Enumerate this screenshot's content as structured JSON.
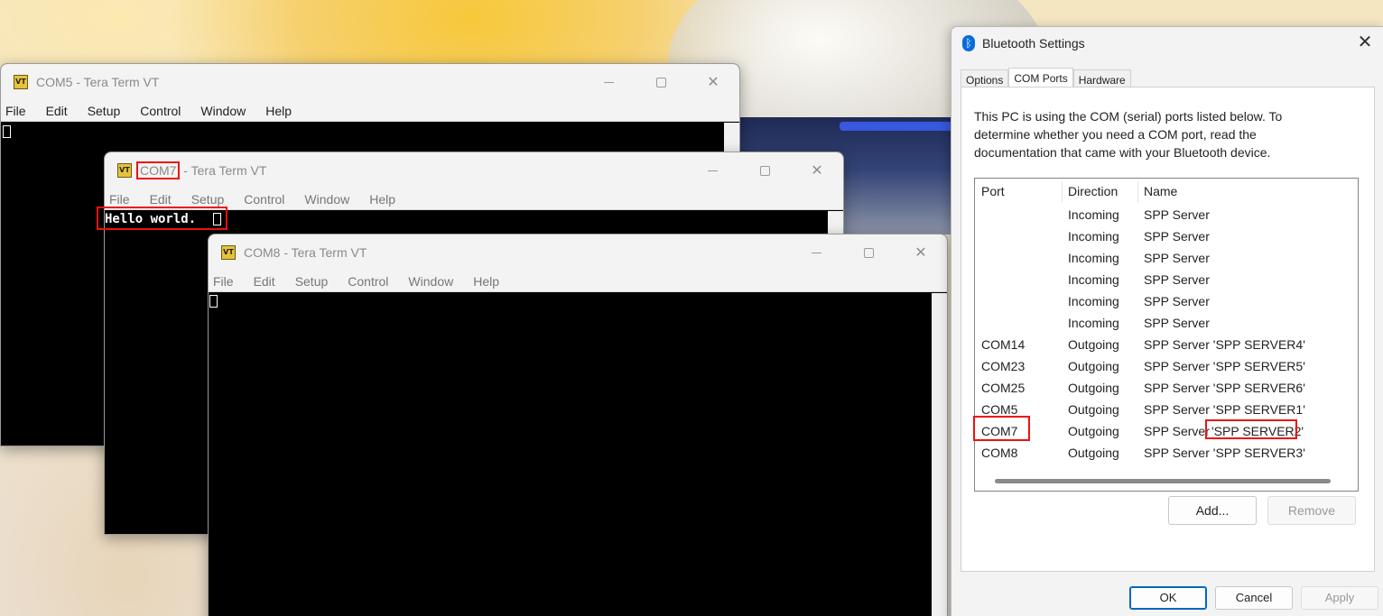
{
  "windows": {
    "com5": {
      "title": "COM5 - Tera Term VT",
      "menu": [
        "File",
        "Edit",
        "Setup",
        "Control",
        "Window",
        "Help"
      ]
    },
    "com7": {
      "title_port": "COM7",
      "title_rest": " - Tera Term VT",
      "menu": [
        "File",
        "Edit",
        "Setup",
        "Control",
        "Window",
        "Help"
      ],
      "terminal_text": "Hello world."
    },
    "com8": {
      "title": "COM8 - Tera Term VT",
      "menu": [
        "File",
        "Edit",
        "Setup",
        "Control",
        "Window",
        "Help"
      ]
    }
  },
  "icons": {
    "tera_term_icon": "VT",
    "bluetooth_icon": "ᛒ",
    "close_icon": "✕"
  },
  "bluetooth": {
    "title": "Bluetooth Settings",
    "tabs": [
      "Options",
      "COM Ports",
      "Hardware"
    ],
    "active_tab": "COM Ports",
    "description": "This PC is using the COM (serial) ports listed below. To determine whether you need a COM port, read the documentation that came with your Bluetooth device.",
    "columns": [
      "Port",
      "Direction",
      "Name"
    ],
    "rows": [
      {
        "port": "",
        "direction": "Incoming",
        "name": "SPP Server"
      },
      {
        "port": "",
        "direction": "Incoming",
        "name": "SPP Server"
      },
      {
        "port": "",
        "direction": "Incoming",
        "name": "SPP Server"
      },
      {
        "port": "",
        "direction": "Incoming",
        "name": "SPP Server"
      },
      {
        "port": "",
        "direction": "Incoming",
        "name": "SPP Server"
      },
      {
        "port": "",
        "direction": "Incoming",
        "name": "SPP Server"
      },
      {
        "port": "COM14",
        "direction": "Outgoing",
        "name": "SPP Server 'SPP SERVER4'"
      },
      {
        "port": "COM23",
        "direction": "Outgoing",
        "name": "SPP Server 'SPP SERVER5'"
      },
      {
        "port": "COM25",
        "direction": "Outgoing",
        "name": "SPP Server 'SPP SERVER6'"
      },
      {
        "port": "COM5",
        "direction": "Outgoing",
        "name": "SPP Server 'SPP SERVER1'"
      },
      {
        "port": "COM7",
        "direction": "Outgoing",
        "name_prefix": "SPP Server ",
        "name_quoted": "'SPP SERVER2'"
      },
      {
        "port": "COM8",
        "direction": "Outgoing",
        "name": "SPP Server 'SPP SERVER3'"
      }
    ],
    "buttons": {
      "add": "Add...",
      "remove": "Remove",
      "ok": "OK",
      "cancel": "Cancel",
      "apply": "Apply"
    }
  },
  "colors": {
    "highlight": "#ee1111",
    "terminal_bg": "#000000",
    "accent": "#0067c0"
  }
}
